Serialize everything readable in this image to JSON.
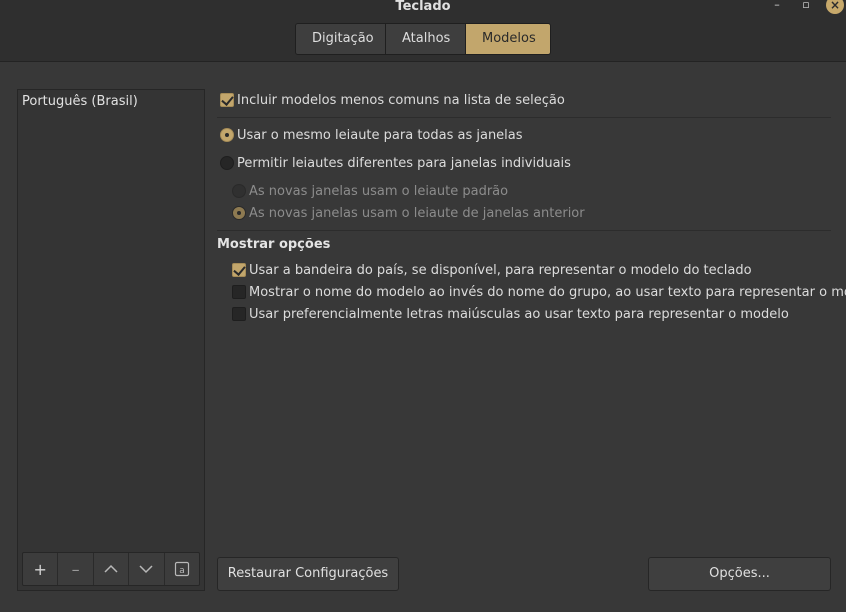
{
  "window": {
    "title": "Teclado",
    "minimize_glyph": "–",
    "maximize_glyph": "▫",
    "close_glyph": "×"
  },
  "tabs": [
    {
      "label": "Digitação",
      "active": false
    },
    {
      "label": "Atalhos",
      "active": false
    },
    {
      "label": "Modelos",
      "active": true
    }
  ],
  "layouts_list": {
    "items": [
      "Português (Brasil)"
    ],
    "toolbar": {
      "add_icon": "+",
      "remove_icon": "–",
      "move_up_icon": "chevron-up-icon",
      "move_down_icon": "chevron-down-icon",
      "preview_icon": "keyboard-preview-icon",
      "preview_glyph": "a"
    }
  },
  "options": {
    "include_uncommon": {
      "label": "Incluir modelos menos comuns na lista de seleção",
      "checked": true
    },
    "same_layout_all": {
      "label": "Usar o mesmo leiaute para todas as janelas",
      "checked": true
    },
    "different_layouts": {
      "label": "Permitir leiautes diferentes para janelas individuais",
      "checked": false
    },
    "new_windows_default": {
      "label": "As novas janelas usam o leiaute padrão",
      "checked": false,
      "enabled": false
    },
    "new_windows_previous": {
      "label": "As novas janelas usam o leiaute de janelas anterior",
      "checked": true,
      "enabled": false
    }
  },
  "display_options": {
    "title": "Mostrar opções",
    "items": [
      {
        "label": "Usar a bandeira do país, se disponível, para representar o modelo do teclado",
        "checked": true
      },
      {
        "label": "Mostrar o nome do modelo ao invés do nome do grupo, ao usar texto para representar o modelo",
        "checked": false
      },
      {
        "label": "Usar preferencialmente letras maiúsculas ao usar texto para representar o modelo",
        "checked": false
      }
    ]
  },
  "buttons": {
    "restore": "Restaurar Configurações",
    "options": "Opções..."
  },
  "colors": {
    "accent": "#c2a66c",
    "background": "#383838",
    "headerbar": "#2f2f2f"
  }
}
